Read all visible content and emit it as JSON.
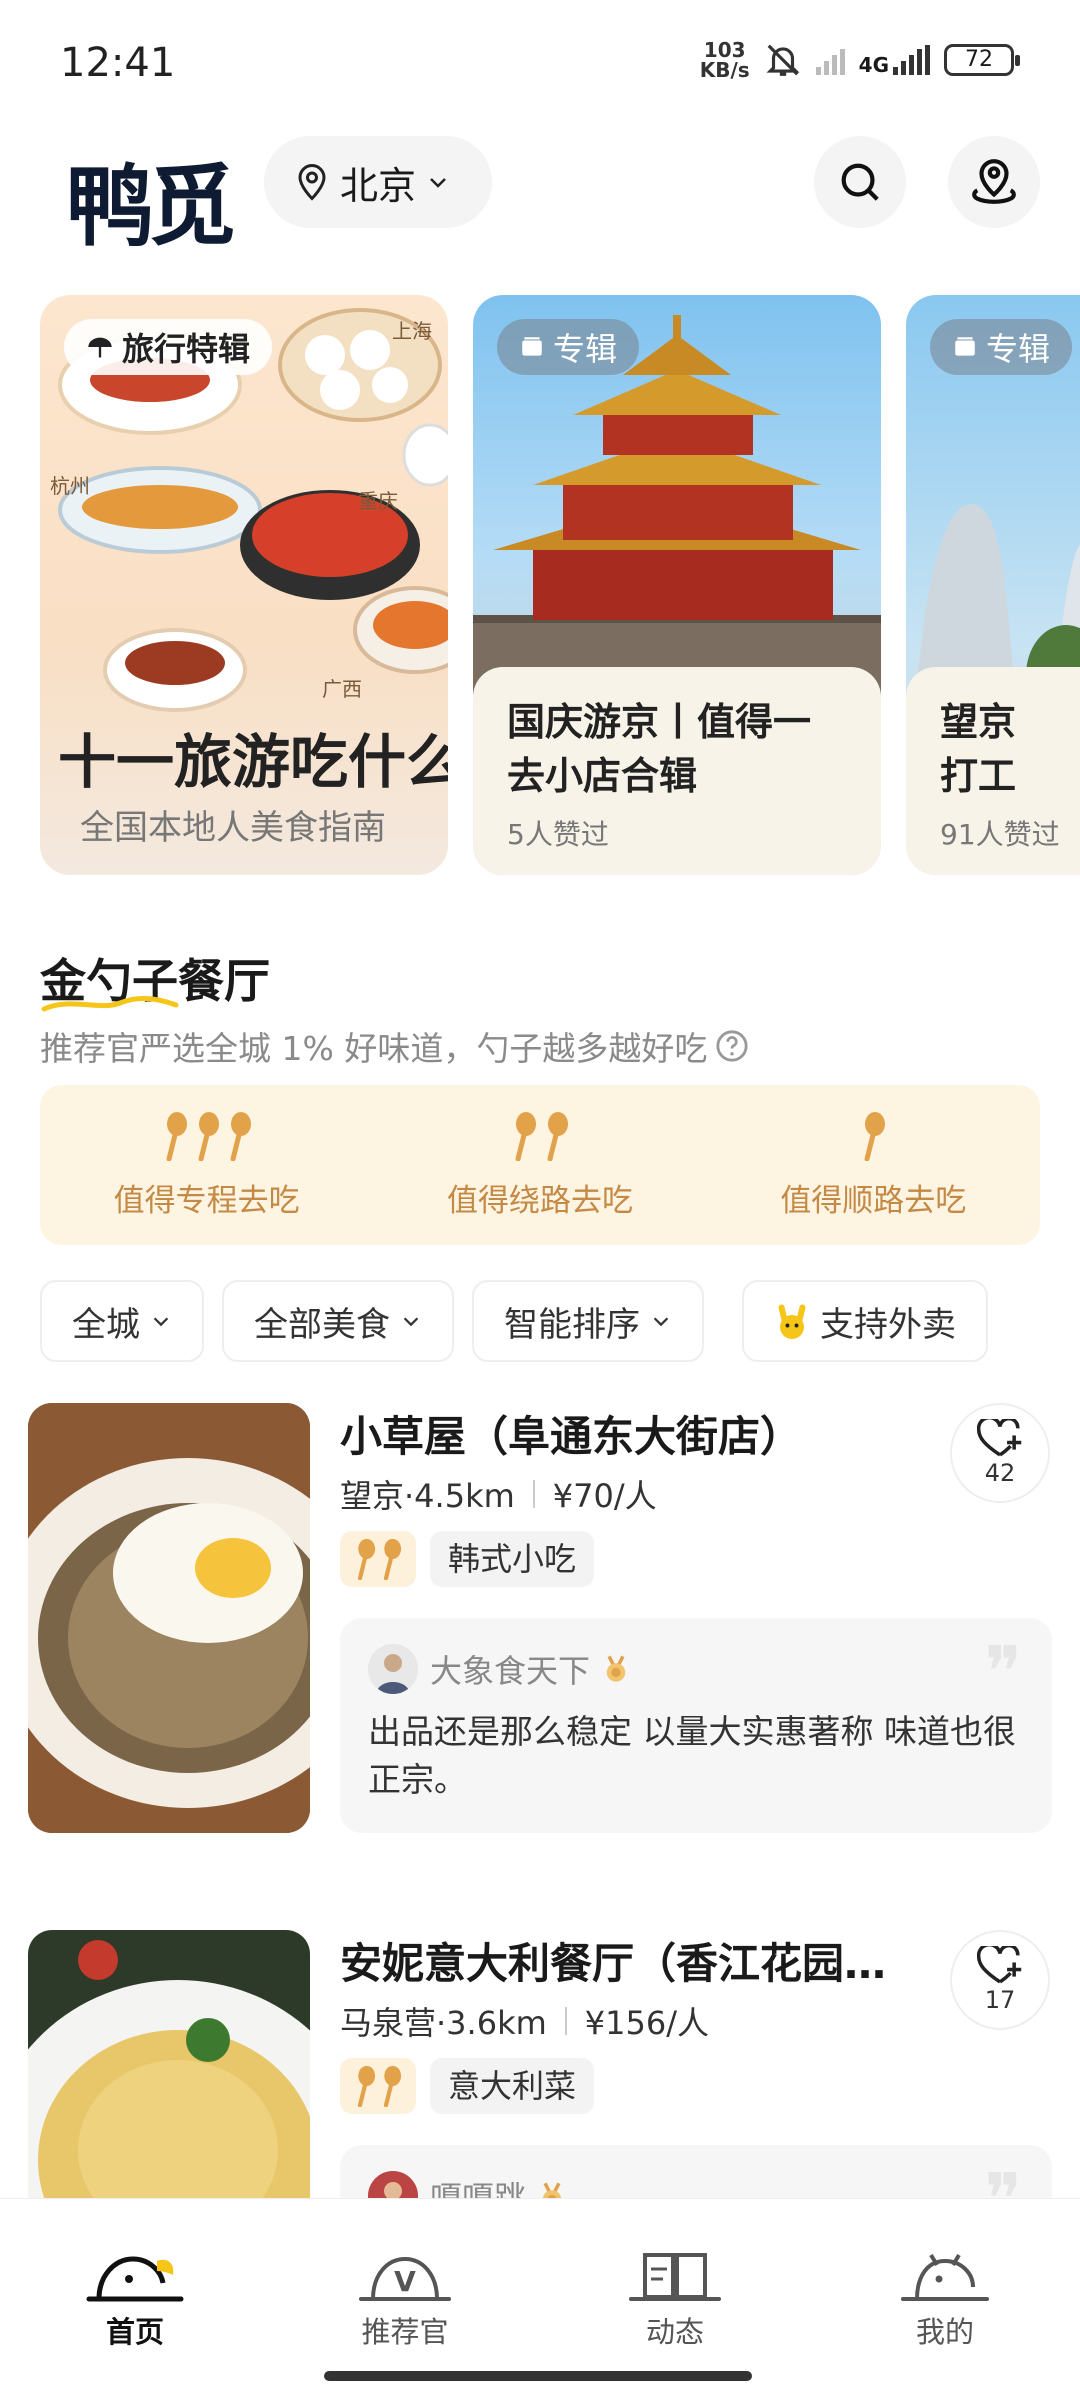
{
  "status_bar": {
    "time": "12:41",
    "net_speed_value": "103",
    "net_speed_unit": "KB/s",
    "network": "4G",
    "battery": "72"
  },
  "header": {
    "app_name": "鸭觅",
    "city": "北京",
    "icons": [
      "search-icon",
      "map-pin-person-icon"
    ]
  },
  "cards": [
    {
      "tag": "旅行特辑",
      "title": "十一旅游吃什么",
      "subtitle": "全国本地人美食指南",
      "map_labels": [
        "上海",
        "杭州",
        "重庆",
        "广西"
      ]
    },
    {
      "tag": "专辑",
      "title": "国庆游京丨值得一去小店合辑",
      "likes": "5人赞过"
    },
    {
      "tag": "专辑",
      "title": "望京打工觅食小报",
      "likes": "91人赞过"
    }
  ],
  "section": {
    "title": "金勺子餐厅",
    "subtitle": "推荐官严选全城 1% 好味道，勺子越多越好吃",
    "spoon_levels": [
      {
        "spoons": 3,
        "label": "值得专程去吃"
      },
      {
        "spoons": 2,
        "label": "值得绕路去吃"
      },
      {
        "spoons": 1,
        "label": "值得顺路去吃"
      }
    ]
  },
  "filters": [
    {
      "label": "全城",
      "has_chevron": true
    },
    {
      "label": "全部美食",
      "has_chevron": true
    },
    {
      "label": "智能排序",
      "has_chevron": true
    },
    {
      "label": "支持外卖",
      "has_chevron": false
    }
  ],
  "restaurants": [
    {
      "name": "小草屋（阜通东大街店）",
      "area_distance": "望京·4.5km",
      "price": "¥70/人",
      "spoons": 2,
      "cuisine": "韩式小吃",
      "favorites": "42",
      "review": {
        "user": "大象食天下",
        "text": "出品还是那么稳定 以量大实惠著称 味道也很正宗。"
      }
    },
    {
      "name": "安妮意大利餐厅（香江花园…",
      "area_distance": "马泉营·3.6km",
      "price": "¥156/人",
      "spoons": 2,
      "cuisine": "意大利菜",
      "favorites": "17",
      "review": {
        "user": "嘎嘎跳",
        "text": ""
      }
    }
  ],
  "bottom_nav": [
    {
      "label": "首页",
      "active": true
    },
    {
      "label": "推荐官",
      "active": false
    },
    {
      "label": "动态",
      "active": false
    },
    {
      "label": "我的",
      "active": false
    }
  ],
  "colors": {
    "spoon_gold": "#e2a24a",
    "spoon_bg": "#fdf4e2",
    "accent_yellow": "#f5c518"
  }
}
